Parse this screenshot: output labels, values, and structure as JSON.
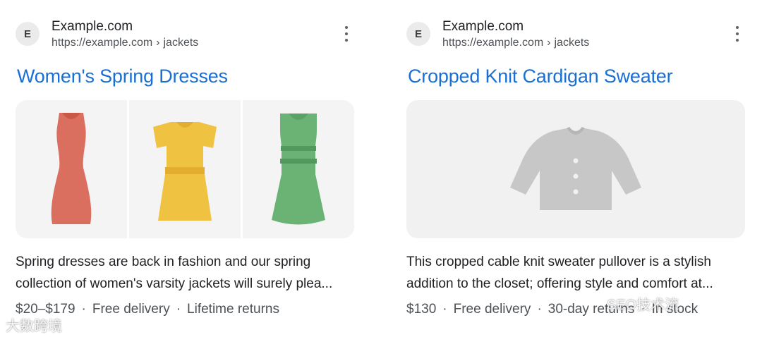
{
  "results": [
    {
      "favicon_letter": "E",
      "site_name": "Example.com",
      "url": "https://example.com",
      "breadcrumb_sep": "›",
      "breadcrumb": "jackets",
      "title": "Women's Spring Dresses",
      "images": [
        "red-dress-icon",
        "yellow-dress-icon",
        "green-dress-icon"
      ],
      "snippet_lines": [
        "Spring dresses are back in fashion and our spring",
        "collection of women's varsity jackets will surely plea..."
      ],
      "price": "$20–$179",
      "sep": "·",
      "delivery": "Free delivery",
      "returns": "Lifetime returns"
    },
    {
      "favicon_letter": "E",
      "site_name": "Example.com",
      "url": "https://example.com",
      "breadcrumb_sep": "›",
      "breadcrumb": "jackets",
      "title": "Cropped Knit Cardigan Sweater",
      "images": [
        "cardigan-icon"
      ],
      "snippet_lines": [
        "This cropped cable knit sweater pullover is a stylish",
        "addition to the closet; offering style and comfort at..."
      ],
      "price": "$130",
      "sep": "·",
      "delivery": "Free delivery",
      "returns": "30-day returns",
      "stock": "In stock"
    }
  ],
  "colors": {
    "title_link": "#1a6fd4",
    "red_dress": "#db6f5f",
    "yellow_dress": "#f0c242",
    "green_dress": "#6ab374",
    "cardigan": "#c7c7c7"
  },
  "watermarks": [
    "大数跨境",
    "SEO技术流"
  ]
}
